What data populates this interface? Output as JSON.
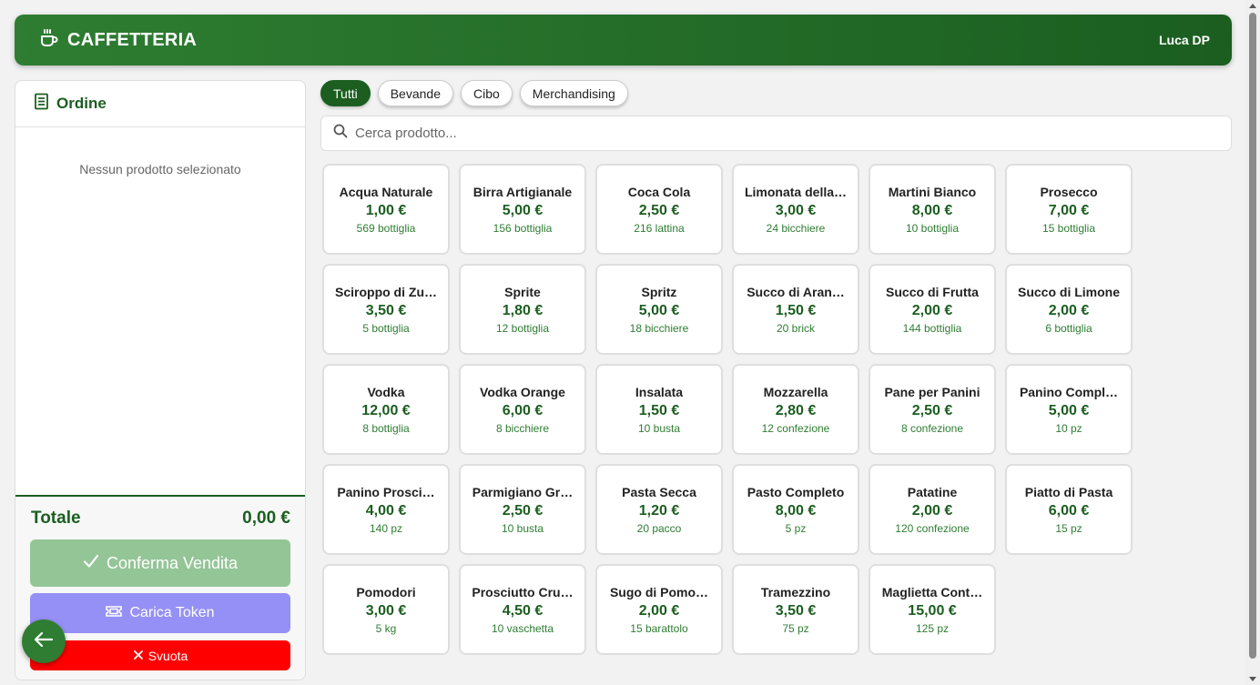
{
  "header": {
    "title": "CAFFETTERIA",
    "user": "Luca DP"
  },
  "order": {
    "title": "Ordine",
    "empty_text": "Nessun prodotto selezionato",
    "total_label": "Totale",
    "total_value": "0,00 €",
    "confirm_label": "Conferma Vendita",
    "token_label": "Carica Token",
    "clear_label": "Svuota"
  },
  "tabs": [
    {
      "label": "Tutti",
      "active": true
    },
    {
      "label": "Bevande",
      "active": false
    },
    {
      "label": "Cibo",
      "active": false
    },
    {
      "label": "Merchandising",
      "active": false
    }
  ],
  "search": {
    "placeholder": "Cerca prodotto..."
  },
  "products": [
    {
      "name": "Acqua Naturale",
      "price": "1,00 €",
      "stock": "569 bottiglia"
    },
    {
      "name": "Birra Artigianale",
      "price": "5,00 €",
      "stock": "156 bottiglia"
    },
    {
      "name": "Coca Cola",
      "price": "2,50 €",
      "stock": "216 lattina"
    },
    {
      "name": "Limonata della…",
      "price": "3,00 €",
      "stock": "24 bicchiere"
    },
    {
      "name": "Martini Bianco",
      "price": "8,00 €",
      "stock": "10 bottiglia"
    },
    {
      "name": "Prosecco",
      "price": "7,00 €",
      "stock": "15 bottiglia"
    },
    {
      "name": "Sciroppo di Zu…",
      "price": "3,50 €",
      "stock": "5 bottiglia"
    },
    {
      "name": "Sprite",
      "price": "1,80 €",
      "stock": "12 bottiglia"
    },
    {
      "name": "Spritz",
      "price": "5,00 €",
      "stock": "18 bicchiere"
    },
    {
      "name": "Succo di Aran…",
      "price": "1,50 €",
      "stock": "20 brick"
    },
    {
      "name": "Succo di Frutta",
      "price": "2,00 €",
      "stock": "144 bottiglia"
    },
    {
      "name": "Succo di Limone",
      "price": "2,00 €",
      "stock": "6 bottiglia"
    },
    {
      "name": "Vodka",
      "price": "12,00 €",
      "stock": "8 bottiglia"
    },
    {
      "name": "Vodka Orange",
      "price": "6,00 €",
      "stock": "8 bicchiere"
    },
    {
      "name": "Insalata",
      "price": "1,50 €",
      "stock": "10 busta"
    },
    {
      "name": "Mozzarella",
      "price": "2,80 €",
      "stock": "12 confezione"
    },
    {
      "name": "Pane per Panini",
      "price": "2,50 €",
      "stock": "8 confezione"
    },
    {
      "name": "Panino Compl…",
      "price": "5,00 €",
      "stock": "10 pz"
    },
    {
      "name": "Panino Prosci…",
      "price": "4,00 €",
      "stock": "140 pz"
    },
    {
      "name": "Parmigiano Gr…",
      "price": "2,50 €",
      "stock": "10 busta"
    },
    {
      "name": "Pasta Secca",
      "price": "1,20 €",
      "stock": "20 pacco"
    },
    {
      "name": "Pasto Completo",
      "price": "8,00 €",
      "stock": "5 pz"
    },
    {
      "name": "Patatine",
      "price": "2,00 €",
      "stock": "120 confezione"
    },
    {
      "name": "Piatto di Pasta",
      "price": "6,00 €",
      "stock": "15 pz"
    },
    {
      "name": "Pomodori",
      "price": "3,00 €",
      "stock": "5 kg"
    },
    {
      "name": "Prosciutto Cru…",
      "price": "4,50 €",
      "stock": "10 vaschetta"
    },
    {
      "name": "Sugo di Pomo…",
      "price": "2,00 €",
      "stock": "15 barattolo"
    },
    {
      "name": "Tramezzino",
      "price": "3,50 €",
      "stock": "75 pz"
    },
    {
      "name": "Maglietta Cont…",
      "price": "15,00 €",
      "stock": "125 pz"
    }
  ],
  "icons": {
    "brand": "coffee-cup-icon",
    "order": "receipt-icon",
    "search": "search-icon",
    "confirm": "checkmark-icon",
    "token": "ticket-icon",
    "clear": "close-icon",
    "back": "arrow-left-icon"
  },
  "colors": {
    "primary": "#1b5e20",
    "confirm": "#94c596",
    "token": "#9590f5",
    "clear": "#ff0000"
  }
}
